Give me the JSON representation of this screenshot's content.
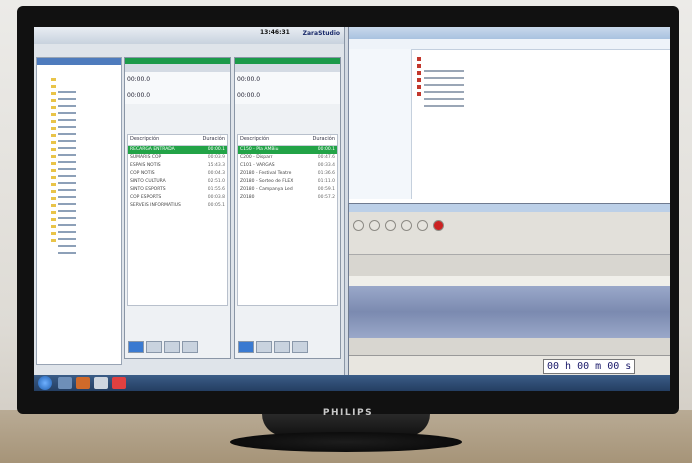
{
  "monitor": {
    "brand": "PHILIPS"
  },
  "zara": {
    "clock": "13:46:31",
    "logo": "ZaraStudio",
    "player1": {
      "counter": "00:00.0",
      "columns": [
        "Descripción",
        "Duración"
      ],
      "rows": [
        {
          "title": "RECARGA ENTRADA",
          "duration": "00:00.1",
          "selected": true
        },
        {
          "title": "SUMARIS COP",
          "duration": "00:03.9",
          "selected": false
        },
        {
          "title": "ESPAIS NOTIS",
          "duration": "15:43.3",
          "selected": false
        },
        {
          "title": "COP NOTIS",
          "duration": "00:04.3",
          "selected": false
        },
        {
          "title": "SINTO CULTURA",
          "duration": "02:51.0",
          "selected": false
        },
        {
          "title": "SINTO ESPORTS",
          "duration": "01:55.6",
          "selected": false
        },
        {
          "title": "COP ESPORTS",
          "duration": "00:03.8",
          "selected": false
        },
        {
          "title": "SERVEIS INFORMATIUS",
          "duration": "00:05.1",
          "selected": false
        }
      ]
    },
    "player2": {
      "counter": "00:00.0",
      "columns": [
        "Descripción",
        "Duración"
      ],
      "rows": [
        {
          "title": "C150 - Pla AMBiu",
          "duration": "00:00.1",
          "selected": true
        },
        {
          "title": "C200 - Disparr",
          "duration": "00:47.6",
          "selected": false
        },
        {
          "title": "C101 - VARGAS",
          "duration": "00:33.4",
          "selected": false
        },
        {
          "title": "Z0180 - Festival Teatre",
          "duration": "01:36.6",
          "selected": false
        },
        {
          "title": "Z0180 - Sorteo de FLEX",
          "duration": "01:11.0",
          "selected": false
        },
        {
          "title": "Z0180 - Campanya Led",
          "duration": "00:59.1",
          "selected": false
        },
        {
          "title": "Z0180",
          "duration": "00:57.2",
          "selected": false
        }
      ]
    }
  },
  "audacity": {
    "timecode": "00 h 00 m 00 s"
  }
}
